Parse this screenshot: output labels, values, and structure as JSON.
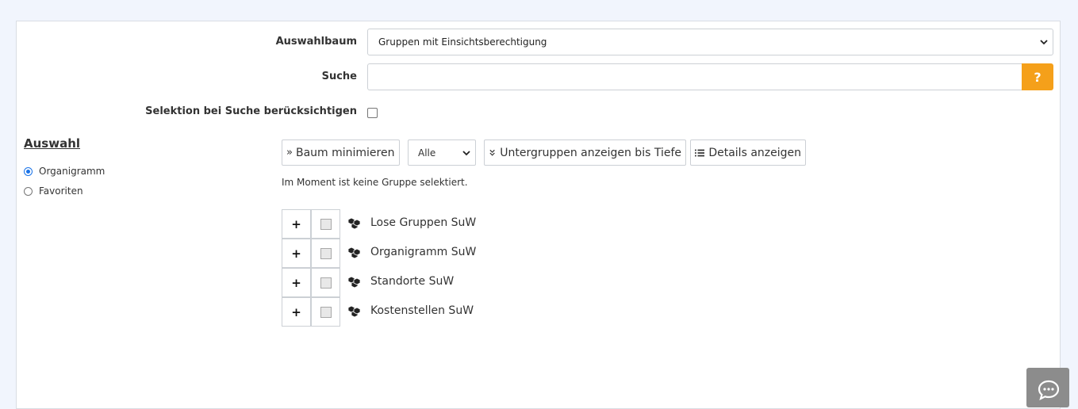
{
  "form": {
    "tree_label": "Auswahlbaum",
    "tree_value": "Gruppen mit Einsichtsberechtigung",
    "search_label": "Suche",
    "search_value": "",
    "search_help": "?",
    "consider_selection_label": "Selektion bei Suche berücksichtigen",
    "consider_selection_checked": false
  },
  "sidebar": {
    "title": "Auswahl",
    "options": [
      {
        "label": "Organigramm",
        "checked": true
      },
      {
        "label": "Favoriten",
        "checked": false
      }
    ]
  },
  "toolbar": {
    "minimize_icon": "double-chevron-right-icon",
    "minimize_label": "Baum minimieren",
    "depth_value": "Alle",
    "subgroups_icon": "double-chevron-down-icon",
    "subgroups_label": "Untergruppen anzeigen bis Tiefe",
    "details_icon": "list-icon",
    "details_label": "Details anzeigen"
  },
  "status_text": "Im Moment ist keine Gruppe selektiert.",
  "tree": {
    "expand_label": "+",
    "items": [
      {
        "label": "Lose Gruppen SuW",
        "icon": "group-icon"
      },
      {
        "label": "Organigramm SuW",
        "icon": "group-icon"
      },
      {
        "label": "Standorte SuW",
        "icon": "group-icon"
      },
      {
        "label": "Kostenstellen SuW",
        "icon": "group-icon"
      }
    ]
  },
  "colors": {
    "accent": "#f5a01a",
    "radio": "#1a73e8",
    "background": "#f1f5fd"
  }
}
